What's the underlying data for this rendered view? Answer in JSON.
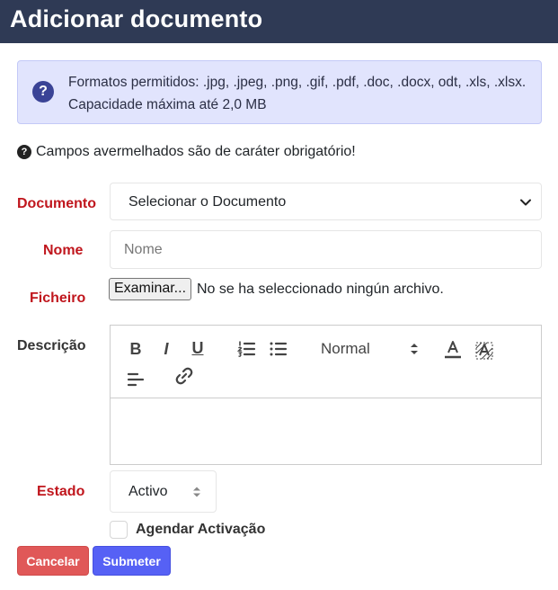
{
  "header": {
    "title": "Adicionar documento"
  },
  "alert": {
    "icon": "question-circle-icon",
    "text": "Formatos permitidos: .jpg, .jpeg, .png, .gif, .pdf, .doc, .docx, odt, .xls, .xlsx. Capacidade máxima até 2,0 MB"
  },
  "note": {
    "icon": "question-circle-icon",
    "text": "Campos avermelhados são de caráter obrigatório!"
  },
  "form": {
    "documento": {
      "label": "Documento",
      "selected": "Selecionar o Documento"
    },
    "nome": {
      "label": "Nome",
      "placeholder": "Nome",
      "value": ""
    },
    "ficheiro": {
      "label": "Ficheiro",
      "button": "Examinar...",
      "status": "No se ha seleccionado ningún archivo."
    },
    "descricao": {
      "label": "Descrição",
      "toolbar": {
        "bold": "B",
        "italic": "I",
        "underline": "U",
        "header_value": "Normal"
      }
    },
    "estado": {
      "label": "Estado",
      "selected": "Activo"
    },
    "agendar": {
      "label": "Agendar Activação",
      "checked": false
    }
  },
  "actions": {
    "cancel": "Cancelar",
    "submit": "Submeter"
  },
  "colors": {
    "header_bg": "#2f3a55",
    "required": "#c0161d",
    "cancel": "#e05858",
    "submit": "#5661f5",
    "alert_bg": "#e1e4fd"
  }
}
